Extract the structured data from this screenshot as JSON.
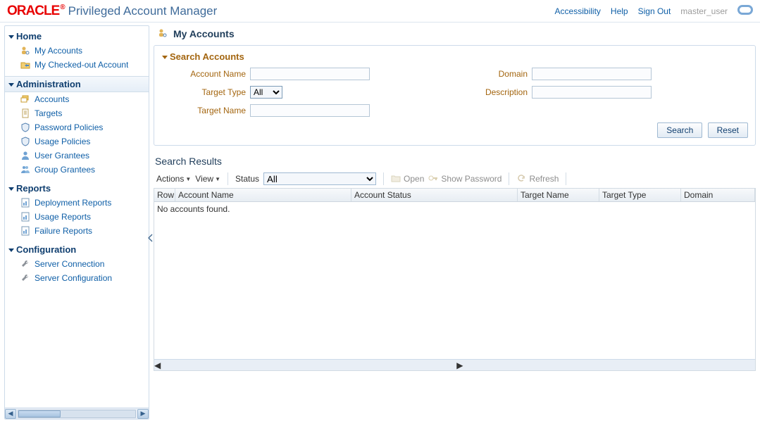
{
  "header": {
    "brand": "ORACLE",
    "product": "Privileged Account Manager",
    "links": {
      "accessibility": "Accessibility",
      "help": "Help",
      "signout": "Sign Out"
    },
    "user": "master_user"
  },
  "sidebar": {
    "groups": [
      {
        "title": "Home",
        "items": [
          {
            "label": "My Accounts",
            "icon": "person-key-icon"
          },
          {
            "label": "My Checked-out Account",
            "icon": "folder-out-icon"
          }
        ]
      },
      {
        "title": "Administration",
        "selected": true,
        "items": [
          {
            "label": "Accounts",
            "icon": "cards-icon"
          },
          {
            "label": "Targets",
            "icon": "page-icon"
          },
          {
            "label": "Password Policies",
            "icon": "shield-icon"
          },
          {
            "label": "Usage Policies",
            "icon": "shield-icon"
          },
          {
            "label": "User Grantees",
            "icon": "user-icon"
          },
          {
            "label": "Group Grantees",
            "icon": "users-icon"
          }
        ]
      },
      {
        "title": "Reports",
        "items": [
          {
            "label": "Deployment Reports",
            "icon": "report-icon"
          },
          {
            "label": "Usage Reports",
            "icon": "report-icon"
          },
          {
            "label": "Failure Reports",
            "icon": "report-icon"
          }
        ]
      },
      {
        "title": "Configuration",
        "items": [
          {
            "label": "Server Connection",
            "icon": "wrench-icon"
          },
          {
            "label": "Server Configuration",
            "icon": "wrench-icon"
          }
        ]
      }
    ]
  },
  "page": {
    "title": "My Accounts",
    "search_panel": {
      "title": "Search Accounts",
      "fields": {
        "account_name_label": "Account Name",
        "target_type_label": "Target Type",
        "target_type_value": "All",
        "target_name_label": "Target Name",
        "domain_label": "Domain",
        "description_label": "Description"
      },
      "buttons": {
        "search": "Search",
        "reset": "Reset"
      }
    },
    "results": {
      "title": "Search Results",
      "toolbar": {
        "actions": "Actions",
        "view": "View",
        "status_label": "Status",
        "status_value": "All",
        "open": "Open",
        "show_password": "Show Password",
        "refresh": "Refresh"
      },
      "columns": {
        "row": "Row",
        "account_name": "Account Name",
        "account_status": "Account Status",
        "target_name": "Target Name",
        "target_type": "Target Type",
        "domain": "Domain"
      },
      "empty": "No accounts found."
    }
  }
}
